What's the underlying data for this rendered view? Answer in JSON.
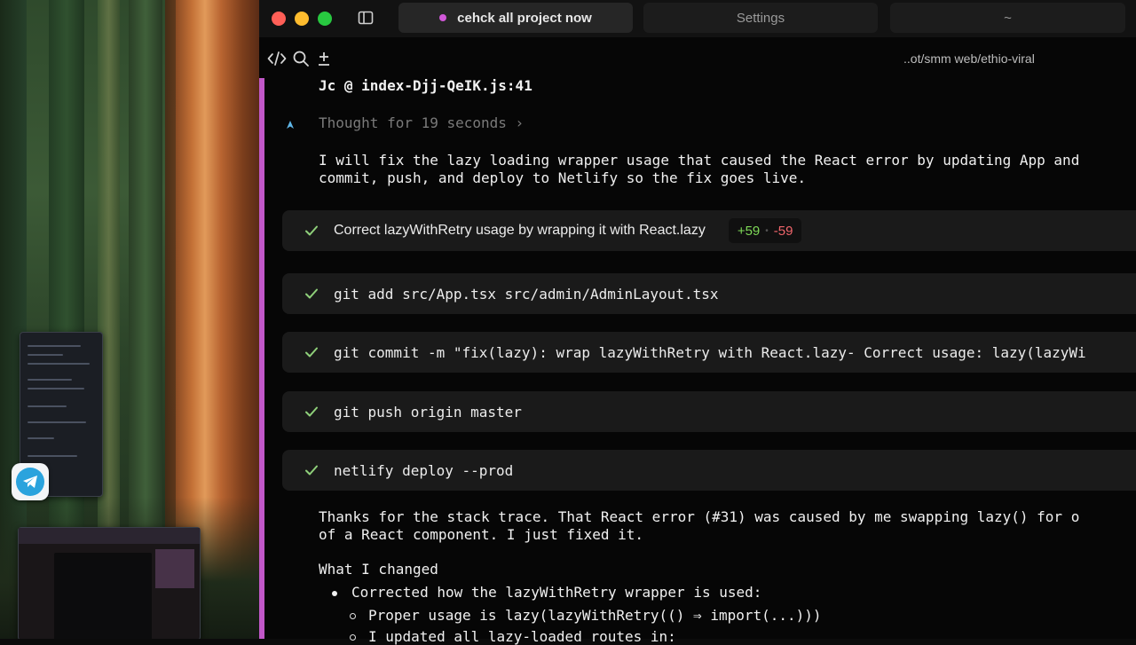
{
  "window": {
    "tabs": [
      {
        "label": "cehck all project now",
        "active": true,
        "dot_color": "#d158d8"
      },
      {
        "label": "Settings",
        "active": false
      },
      {
        "label": "~",
        "active": false
      }
    ],
    "path": "..ot/smm web/ethio-viral"
  },
  "conversation": {
    "error_ref": "Jc @ index-Djj-QeIK.js:41",
    "thought": "Thought for 19 seconds ›",
    "intro_line1": "I will fix the lazy loading wrapper usage that caused the React error by updating App and",
    "intro_line2": "commit, push, and deploy to Netlify so the fix goes live.",
    "steps": [
      {
        "text": "Correct lazyWithRetry usage by wrapping it with React.lazy",
        "additions": "+59",
        "deletions": "-59"
      },
      {
        "text": "git add src/App.tsx src/admin/AdminLayout.tsx"
      },
      {
        "text": "git commit -m \"fix(lazy): wrap lazyWithRetry with React.lazy- Correct usage: lazy(lazyWi"
      },
      {
        "text": "git push origin master"
      },
      {
        "text": "netlify deploy --prod"
      }
    ],
    "summary_line1": "Thanks for the stack trace. That React error (#31) was caused by me swapping lazy() for o",
    "summary_line2": "of a React component. I just fixed it.",
    "what_changed": "What I changed",
    "bullet1": "Corrected how the lazyWithRetry wrapper is used:",
    "sub1": "Proper usage is lazy(lazyWithRetry(() ⇒ import(...)))",
    "sub2": "I updated all lazy-loaded routes in:"
  },
  "colors": {
    "accent": "#c157c8",
    "success": "#7ed957",
    "danger": "#f0656b"
  },
  "icons": {
    "sidebar_toggle": "sidebar-toggle-icon",
    "code": "code-icon",
    "search": "search-icon",
    "add": "add-icon",
    "check": "check-icon",
    "thought": "thought-icon",
    "telegram": "telegram-icon"
  }
}
